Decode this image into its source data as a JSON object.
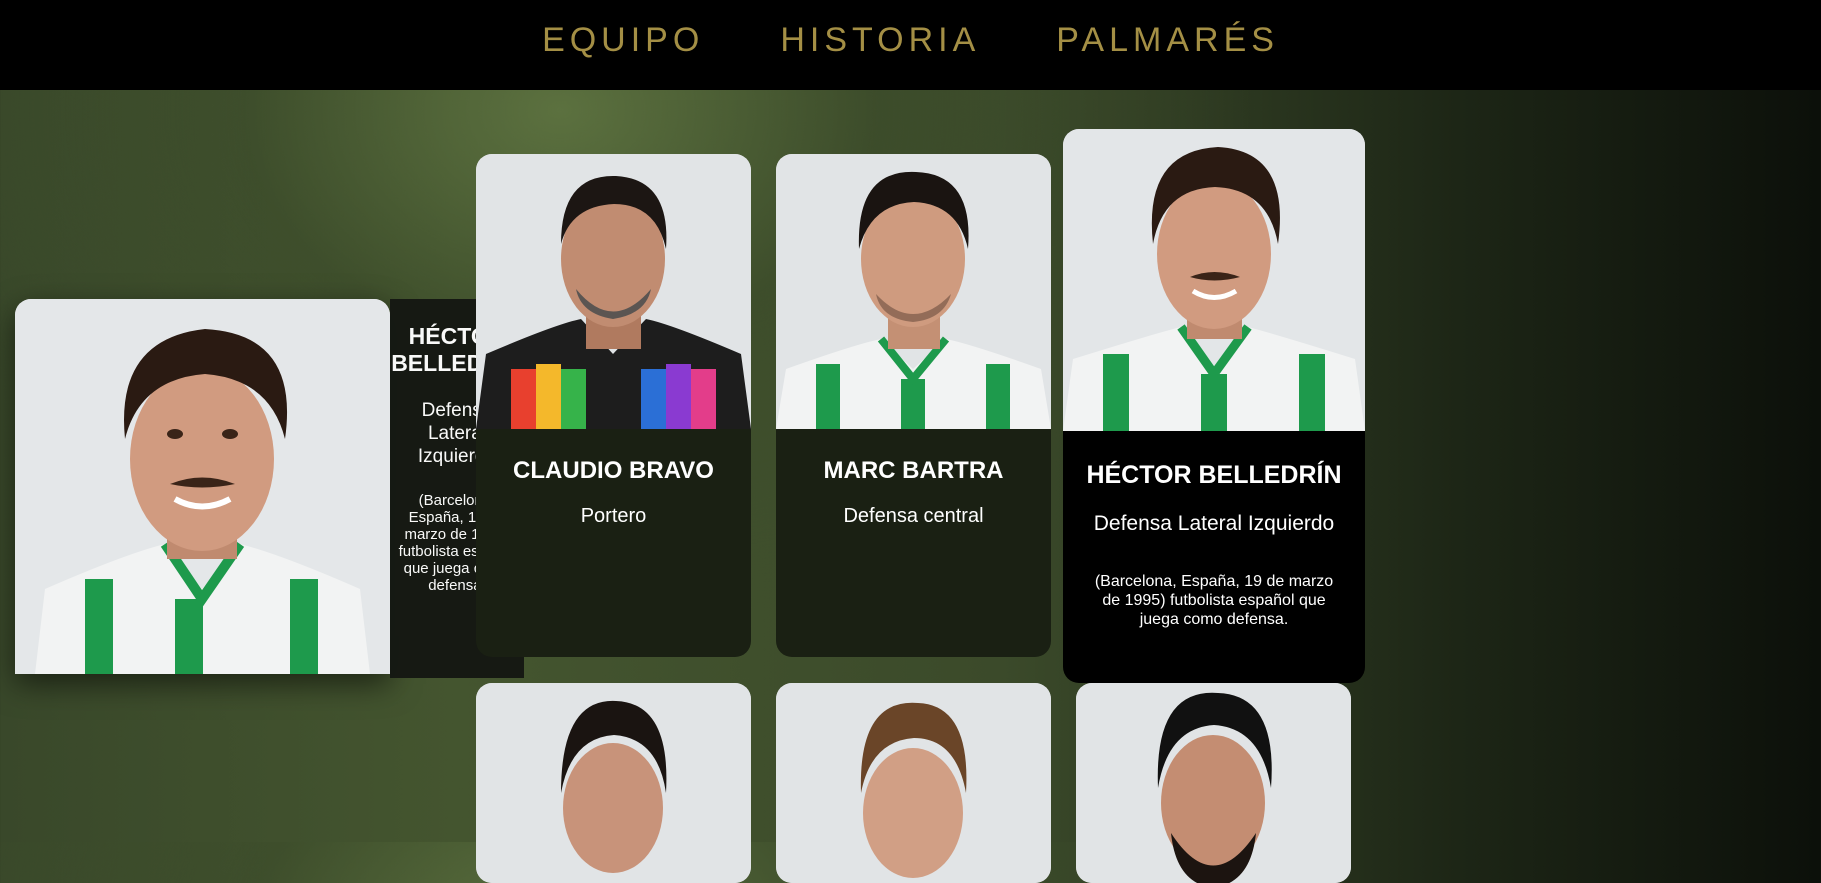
{
  "nav": {
    "items": [
      "EQUIPO",
      "HISTORIA",
      "PALMARÉS"
    ]
  },
  "expanded": {
    "name": "HÉCTOR BELLEDRÍN",
    "role": "Defensa Lateral Izquierdo",
    "description": "(Barcelona, España, 19 de marzo de 1995) futbolista español que juega como defensa."
  },
  "players": [
    {
      "name": "CLAUDIO BRAVO",
      "role": "Portero",
      "description": ""
    },
    {
      "name": "MARC BARTRA",
      "role": "Defensa central",
      "description": ""
    },
    {
      "name": "HÉCTOR BELLEDRÍN",
      "role": "Defensa Lateral Izquierdo",
      "description": "(Barcelona, España, 19 de marzo de 1995) futbolista español que juega como defensa."
    }
  ],
  "colors": {
    "nav_bg": "#000000",
    "nav_text": "#a48f45",
    "kit_green": "#1e9a4c",
    "card_bg": "#1a2013"
  }
}
